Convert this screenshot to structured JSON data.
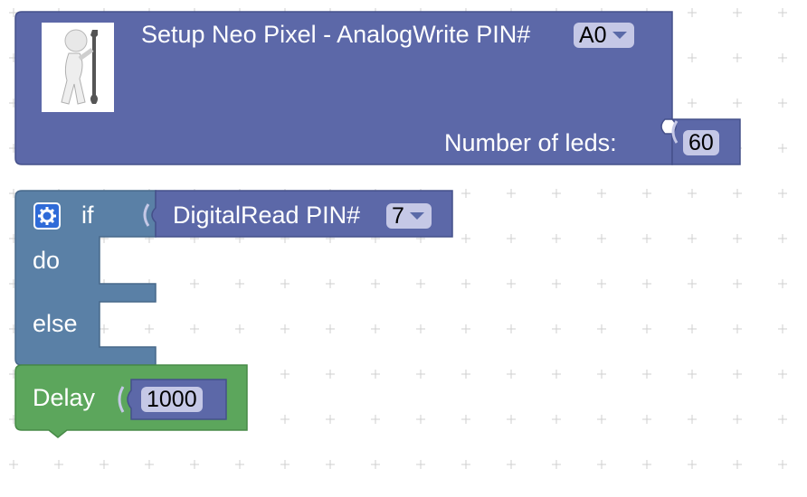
{
  "setup_block": {
    "title": "Setup Neo Pixel - AnalogWrite PIN#",
    "pin_value": "A0",
    "leds_label": "Number of leds:",
    "leds_value": "60",
    "icon": "wrench-figure-icon",
    "color": "#5c68a8"
  },
  "if_block": {
    "if_label": "if",
    "do_label": "do",
    "else_label": "else",
    "icon": "gear-icon",
    "color": "#5a80a6"
  },
  "digital_read_block": {
    "label": "DigitalRead PIN#",
    "pin_value": "7",
    "color": "#5c68a8"
  },
  "delay_block": {
    "label": "Delay",
    "value": "1000",
    "color": "#5ca65c"
  }
}
